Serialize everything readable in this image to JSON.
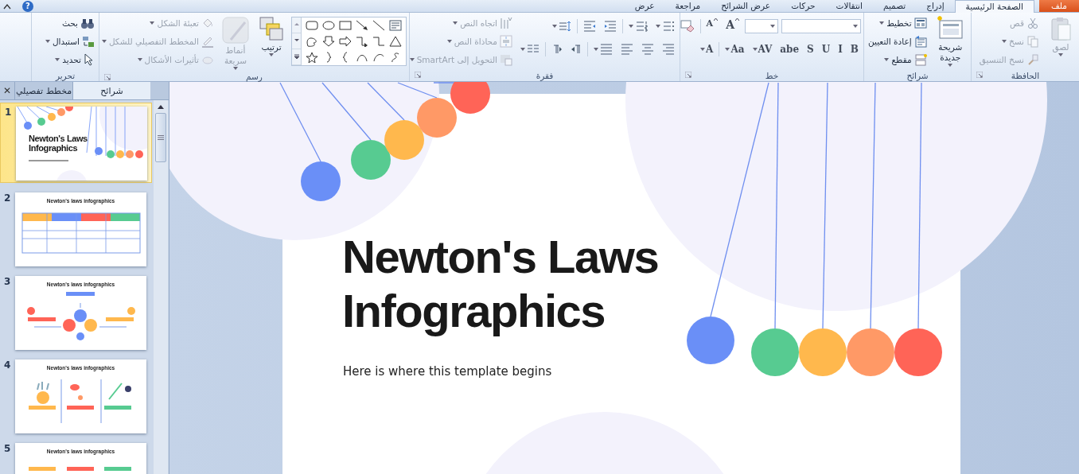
{
  "help_button": {
    "glyph": "?"
  },
  "ribbon_tabs": [
    {
      "label": "ملف",
      "kind": "file",
      "selected": false
    },
    {
      "label": "الصفحة الرئيسية",
      "kind": "tab",
      "selected": true
    },
    {
      "label": "إدراج",
      "kind": "tab",
      "selected": false
    },
    {
      "label": "تصميم",
      "kind": "tab",
      "selected": false
    },
    {
      "label": "انتقالات",
      "kind": "tab",
      "selected": false
    },
    {
      "label": "حركات",
      "kind": "tab",
      "selected": false
    },
    {
      "label": "عرض الشرائح",
      "kind": "tab",
      "selected": false
    },
    {
      "label": "مراجعة",
      "kind": "tab",
      "selected": false
    },
    {
      "label": "عرض",
      "kind": "tab",
      "selected": false
    }
  ],
  "ribbon_groups": [
    {
      "label": "الحافظة",
      "launcher": true,
      "items": [
        {
          "kind": "large",
          "label": "لصق",
          "dropdown": true,
          "disabled": true
        },
        {
          "kind": "stack",
          "items": [
            {
              "label": "قص",
              "dropdown": false,
              "disabled": true
            },
            {
              "label": "نسخ",
              "dropdown": true,
              "disabled": true
            },
            {
              "label": "نسخ التنسيق",
              "dropdown": false,
              "disabled": true
            }
          ]
        }
      ]
    },
    {
      "label": "شرائح",
      "launcher": false,
      "items": [
        {
          "kind": "large",
          "label": "شريحة جديدة",
          "dropdown": true,
          "disabled": false
        },
        {
          "kind": "stack",
          "items": [
            {
              "label": "تخطيط",
              "dropdown": true,
              "disabled": false
            },
            {
              "label": "إعادة التعيين",
              "dropdown": false,
              "disabled": false
            },
            {
              "label": "مقطع",
              "dropdown": true,
              "disabled": false
            }
          ]
        }
      ]
    },
    {
      "label": "خط",
      "launcher": true,
      "items": [
        {
          "kind": "rows",
          "rows": [
            {
              "buttons": [
                {
                  "kind": "combo-wide"
                },
                {
                  "kind": "combo-narrow"
                },
                {
                  "kind": "glyph-grow",
                  "text": "A"
                },
                {
                  "kind": "glyph-shrink",
                  "text": "A"
                },
                {
                  "kind": "sep"
                },
                {
                  "kind": "icon",
                  "dropdown": false
                }
              ]
            },
            {
              "buttons": [
                {
                  "kind": "glyph",
                  "text": "B",
                  "dropdown": false
                },
                {
                  "kind": "glyph",
                  "text": "I",
                  "dropdown": false
                },
                {
                  "kind": "glyph",
                  "text": "U",
                  "dropdown": false
                },
                {
                  "kind": "glyph",
                  "text": "S",
                  "dropdown": false
                },
                {
                  "kind": "glyph",
                  "text": "abe",
                  "dropdown": false
                },
                {
                  "kind": "glyph",
                  "text": "AV",
                  "dropdown": true
                },
                {
                  "kind": "glyph",
                  "text": "Aa",
                  "dropdown": true
                },
                {
                  "kind": "sep"
                },
                {
                  "kind": "glyph",
                  "text": "A",
                  "dropdown": true
                }
              ]
            }
          ]
        }
      ]
    },
    {
      "label": "فقرة",
      "launcher": true,
      "items": [
        {
          "kind": "rows",
          "rows": [
            {
              "buttons": [
                {
                  "kind": "icon",
                  "dropdown": true
                },
                {
                  "kind": "icon",
                  "dropdown": true
                },
                {
                  "kind": "sep"
                },
                {
                  "kind": "icon",
                  "dropdown": false
                },
                {
                  "kind": "icon",
                  "dropdown": false
                },
                {
                  "kind": "sep"
                },
                {
                  "kind": "icon",
                  "dropdown": true
                }
              ]
            },
            {
              "buttons": [
                {
                  "kind": "icon",
                  "dropdown": false
                },
                {
                  "kind": "icon",
                  "dropdown": false
                },
                {
                  "kind": "icon",
                  "dropdown": false
                },
                {
                  "kind": "icon",
                  "dropdown": true
                },
                {
                  "kind": "sep"
                },
                {
                  "kind": "icon",
                  "dropdown": false
                },
                {
                  "kind": "icon",
                  "dropdown": false
                },
                {
                  "kind": "sep"
                },
                {
                  "kind": "icon",
                  "dropdown": true
                }
              ]
            }
          ]
        },
        {
          "kind": "stack",
          "items": [
            {
              "label": "اتجاه النص",
              "dropdown": true,
              "disabled": true
            },
            {
              "label": "محاذاة النص",
              "dropdown": true,
              "disabled": true
            },
            {
              "label": "التحويل إلى SmartArt",
              "dropdown": true,
              "disabled": true
            }
          ]
        }
      ]
    },
    {
      "label": "رسم",
      "launcher": true,
      "items": [
        {
          "kind": "gallery"
        },
        {
          "kind": "large",
          "label": "ترتيب",
          "dropdown": true,
          "disabled": false
        },
        {
          "kind": "large",
          "label": "أنماط سريعة",
          "dropdown": true,
          "disabled": true
        },
        {
          "kind": "stack",
          "items": [
            {
              "label": "تعبئة الشكل",
              "dropdown": true,
              "disabled": true
            },
            {
              "label": "المخطط التفصيلي للشكل",
              "dropdown": true,
              "disabled": true
            },
            {
              "label": "تأثيرات الأشكال",
              "dropdown": true,
              "disabled": true
            }
          ]
        }
      ]
    },
    {
      "label": "تحرير",
      "launcher": false,
      "items": [
        {
          "kind": "stack",
          "items": [
            {
              "label": "بحث",
              "dropdown": false,
              "disabled": false
            },
            {
              "label": "استبدال",
              "dropdown": true,
              "disabled": false
            },
            {
              "label": "تحديد",
              "dropdown": true,
              "disabled": false
            }
          ]
        }
      ]
    }
  ],
  "panel_tabs": [
    {
      "label": "شرائح",
      "selected": true
    },
    {
      "label": "مخطط تفصيلي",
      "selected": false
    }
  ],
  "panel_close": {
    "glyph": "✕"
  },
  "slides": [
    {
      "number": "1",
      "kind": "title",
      "title": "Newton's Laws Infographics",
      "selected": true
    },
    {
      "number": "2",
      "kind": "table",
      "title": "Newton's laws infographics",
      "selected": false
    },
    {
      "number": "3",
      "kind": "diagram",
      "title": "Newton's laws infographics",
      "selected": false
    },
    {
      "number": "4",
      "kind": "columns",
      "title": "Newton's laws infographics",
      "selected": false
    },
    {
      "number": "5",
      "kind": "labels",
      "title": "Newton's laws infographics",
      "selected": false
    }
  ],
  "slide": {
    "title": "Newton's Laws Infographics",
    "subtitle": "Here is where this template begins"
  }
}
